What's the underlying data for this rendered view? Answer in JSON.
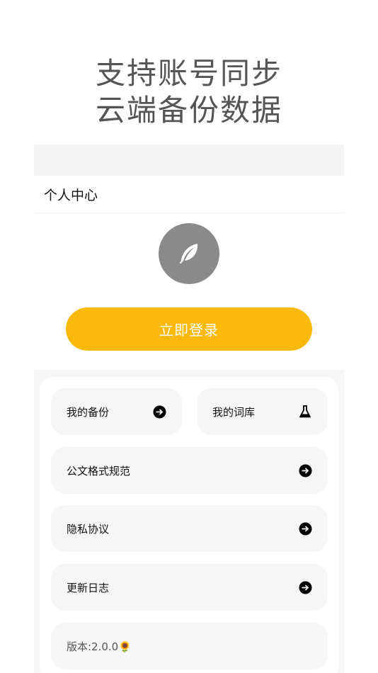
{
  "promo": {
    "line1": "支持账号同步",
    "line2": "云端备份数据"
  },
  "header": {
    "title": "个人中心"
  },
  "avatar": {
    "icon": "feather-icon"
  },
  "login": {
    "label": "立即登录"
  },
  "menu": {
    "backup": {
      "label": "我的备份",
      "icon": "arrow-right-circle-icon"
    },
    "wordbank": {
      "label": "我的词库",
      "icon": "flask-icon"
    },
    "format": {
      "label": "公文格式规范",
      "icon": "arrow-right-circle-icon"
    },
    "privacy": {
      "label": "隐私协议",
      "icon": "arrow-right-circle-icon"
    },
    "changelog": {
      "label": "更新日志",
      "icon": "arrow-right-circle-icon"
    },
    "version": {
      "label": "版本:2.0.0🌻"
    }
  },
  "colors": {
    "accent": "#fbb90c",
    "avatar_bg": "#8a8a8a",
    "tile_bg": "#f6f6f6",
    "promo_text": "#555555"
  }
}
